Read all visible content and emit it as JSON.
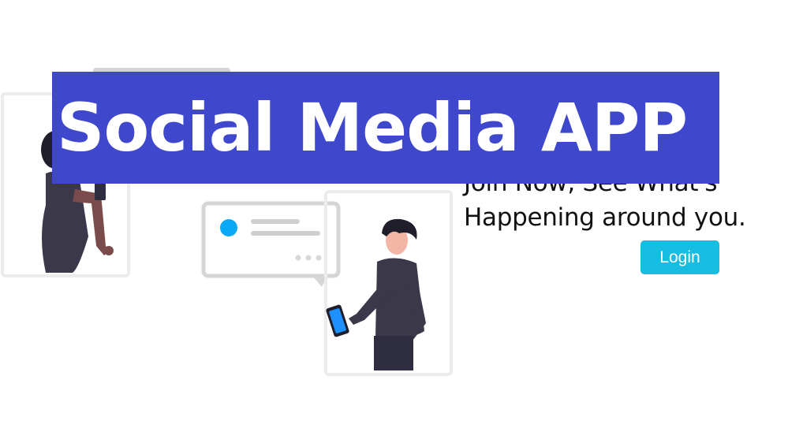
{
  "header": {
    "title": "Social Media APP"
  },
  "hero": {
    "tagline_line1": "Join Now, See What's",
    "tagline_line2": "Happening around you."
  },
  "actions": {
    "login_label": "Login"
  },
  "colors": {
    "banner": "#3f48cc",
    "login_button": "#17bde0",
    "phone_screen": "#1e90ff",
    "frame_border": "#e8e8e8",
    "figure_clothes": "#3b3949"
  },
  "illustration": {
    "name": "people-with-phones-illustration",
    "icons": [
      "person-with-phone",
      "chat-bubble",
      "avatar-dot"
    ]
  }
}
